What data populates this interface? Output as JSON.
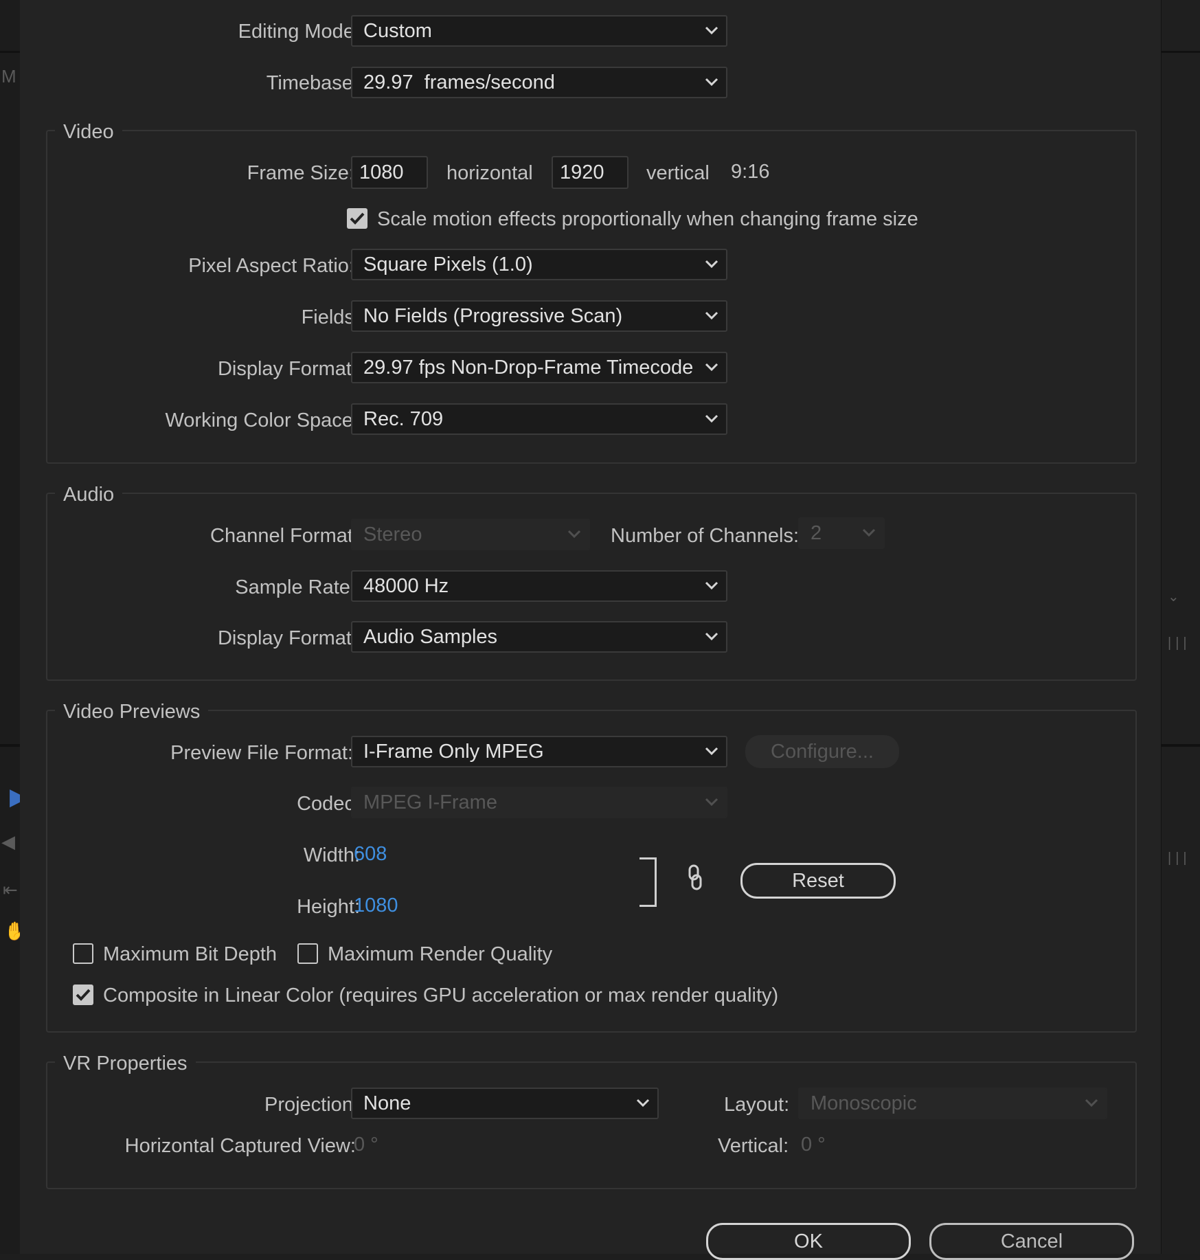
{
  "editing_mode": {
    "label": "Editing Mode:",
    "value": "Custom"
  },
  "timebase": {
    "label": "Timebase:",
    "value": "29.97  frames/second"
  },
  "video": {
    "title": "Video",
    "frame_size_label": "Frame Size:",
    "width": "1080",
    "horizontal_label": "horizontal",
    "height": "1920",
    "vertical_label": "vertical",
    "aspect": "9:16",
    "scale_motion_label": "Scale motion effects proportionally when changing frame size",
    "scale_motion_checked": true,
    "pixel_aspect_label": "Pixel Aspect Ratio:",
    "pixel_aspect_value": "Square Pixels (1.0)",
    "fields_label": "Fields:",
    "fields_value": "No Fields (Progressive Scan)",
    "display_format_label": "Display Format:",
    "display_format_value": "29.97 fps Non-Drop-Frame Timecode",
    "color_space_label": "Working Color Space:",
    "color_space_value": "Rec. 709"
  },
  "audio": {
    "title": "Audio",
    "channel_format_label": "Channel Format:",
    "channel_format_value": "Stereo",
    "num_channels_label": "Number of Channels:",
    "num_channels_value": "2",
    "sample_rate_label": "Sample Rate:",
    "sample_rate_value": "48000 Hz",
    "display_format_label": "Display Format:",
    "display_format_value": "Audio Samples"
  },
  "previews": {
    "title": "Video Previews",
    "file_format_label": "Preview File Format:",
    "file_format_value": "I-Frame Only MPEG",
    "configure_label": "Configure...",
    "codec_label": "Codec:",
    "codec_value": "MPEG I-Frame",
    "width_label": "Width:",
    "width_value": "608",
    "height_label": "Height:",
    "height_value": "1080",
    "reset_label": "Reset",
    "max_bit_depth_label": "Maximum Bit Depth",
    "max_bit_depth_checked": false,
    "max_render_quality_label": "Maximum Render Quality",
    "max_render_quality_checked": false,
    "linear_color_label": "Composite in Linear Color (requires GPU acceleration or max render quality)",
    "linear_color_checked": true
  },
  "vr": {
    "title": "VR Properties",
    "projection_label": "Projection:",
    "projection_value": "None",
    "layout_label": "Layout:",
    "layout_value": "Monoscopic",
    "h_view_label": "Horizontal Captured View:",
    "h_view_value": "0 °",
    "vertical_label": "Vertical:",
    "vertical_value": "0 °"
  },
  "buttons": {
    "ok": "OK",
    "cancel": "Cancel"
  },
  "background": {
    "left_letter": "M"
  },
  "colors": {
    "dialog_bg": "#232323",
    "field_bg": "#1b1b1b",
    "link_blue": "#3f8fe0",
    "disabled_text": "#585858"
  }
}
